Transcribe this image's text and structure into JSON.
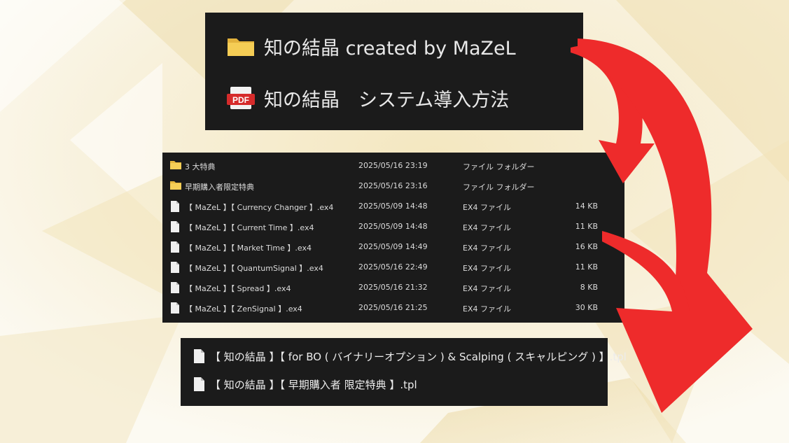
{
  "top_panel": {
    "items": [
      {
        "name": "知の結晶 created by MaZeL",
        "icon": "folder-icon"
      },
      {
        "name": "知の結晶　システム導入方法",
        "icon": "pdf-icon",
        "icon_text": "PDF"
      }
    ]
  },
  "file_list": {
    "rows": [
      {
        "name": "3 大特典",
        "date": "2025/05/16 23:19",
        "type": "ファイル フォルダー",
        "size": "",
        "icon": "folder-icon"
      },
      {
        "name": "早期購入者限定特典",
        "date": "2025/05/16 23:16",
        "type": "ファイル フォルダー",
        "size": "",
        "icon": "folder-icon"
      },
      {
        "name": "【 MaZeL 】【 Currency Changer 】.ex4",
        "date": "2025/05/09 14:48",
        "type": "EX4 ファイル",
        "size": "14 KB",
        "icon": "file-icon"
      },
      {
        "name": "【 MaZeL 】【 Current Time 】.ex4",
        "date": "2025/05/09 14:48",
        "type": "EX4 ファイル",
        "size": "11 KB",
        "icon": "file-icon"
      },
      {
        "name": "【 MaZeL 】【 Market Time 】.ex4",
        "date": "2025/05/09 14:49",
        "type": "EX4 ファイル",
        "size": "16 KB",
        "icon": "file-icon"
      },
      {
        "name": "【 MaZeL 】【 QuantumSignal 】.ex4",
        "date": "2025/05/16 22:49",
        "type": "EX4 ファイル",
        "size": "11 KB",
        "icon": "file-icon"
      },
      {
        "name": "【 MaZeL 】【 Spread 】.ex4",
        "date": "2025/05/16 21:32",
        "type": "EX4 ファイル",
        "size": "8 KB",
        "icon": "file-icon"
      },
      {
        "name": "【 MaZeL 】【 ZenSignal 】.ex4",
        "date": "2025/05/16 21:25",
        "type": "EX4 ファイル",
        "size": "30 KB",
        "icon": "file-icon"
      }
    ]
  },
  "template_files": {
    "items": [
      {
        "name": "【 知の結晶 】【 for BO ( バイナリーオプション ) & Scalping ( スキャルピング ) 】.tpl",
        "icon": "file-icon"
      },
      {
        "name": "【 知の結晶 】【 早期購入者 限定特典 】.tpl",
        "icon": "file-icon"
      }
    ]
  },
  "colors": {
    "panel_bg": "#1b1b1b",
    "folder": "#f2c94c",
    "pdf_red": "#d62b2b",
    "arrow_red": "#ee2b2b",
    "background_gold": "#e9d9a6"
  }
}
